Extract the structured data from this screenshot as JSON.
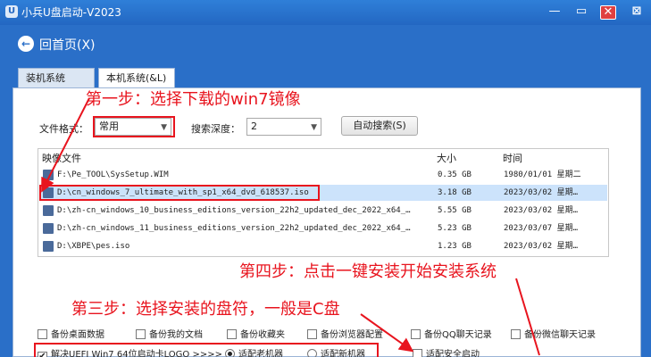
{
  "window": {
    "title": "小兵U盘启动-V2023",
    "min": "—",
    "max": "▭",
    "close": "✕",
    "extra": "⊠"
  },
  "home": {
    "label": "回首页(X)",
    "icon": "←"
  },
  "tabs": [
    {
      "label": "装机系统(&N)"
    },
    {
      "label": "本机系统(&L)"
    }
  ],
  "annotations": {
    "step1": "第一步：选择下载的win7镜像",
    "step3": "第三步：选择安装的盘符，一般是C盘",
    "step4": "第四步：点击一键安装开始安装系统"
  },
  "filters": {
    "format_label": "文件格式：",
    "format_value": "常用",
    "depth_label": "搜索深度：",
    "depth_value": "2",
    "auto_search": "自动搜索(S)"
  },
  "table": {
    "headers": {
      "file": "映像文件",
      "size": "大小",
      "time": "时间"
    },
    "rows": [
      {
        "file": "F:\\Pe_TOOL\\SysSetup.WIM",
        "size": "0.35 GB",
        "time": "1980/01/01 星期二",
        "selected": false
      },
      {
        "file": "D:\\cn_windows_7_ultimate_with_sp1_x64_dvd_618537.iso",
        "size": "3.18 GB",
        "time": "2023/03/02 星期…",
        "selected": true
      },
      {
        "file": "D:\\zh-cn_windows_10_business_editions_version_22h2_updated_dec_2022_x64_…",
        "size": "5.55 GB",
        "time": "2023/03/02 星期…",
        "selected": false
      },
      {
        "file": "D:\\zh-cn_windows_11_business_editions_version_22h2_updated_dec_2022_x64_…",
        "size": "5.23 GB",
        "time": "2023/03/07 星期…",
        "selected": false
      },
      {
        "file": "D:\\XBPE\\pes.iso",
        "size": "1.23 GB",
        "time": "2023/03/02 星期…",
        "selected": false
      }
    ]
  },
  "backups": [
    "备份桌面数据",
    "备份我的文档",
    "备份收藏夹",
    "备份浏览器配置",
    "备份QQ聊天记录",
    "备份微信聊天记录"
  ],
  "options": {
    "uefi": "解决UEFI Win7 64位启动卡LOGO >>>>",
    "adapt_old": "适配老机器",
    "adapt_new": "适配新机器",
    "safe_boot": "适配安全启动"
  },
  "colors": {
    "accent": "#2a6fc8",
    "annotation": "#e8141e"
  }
}
